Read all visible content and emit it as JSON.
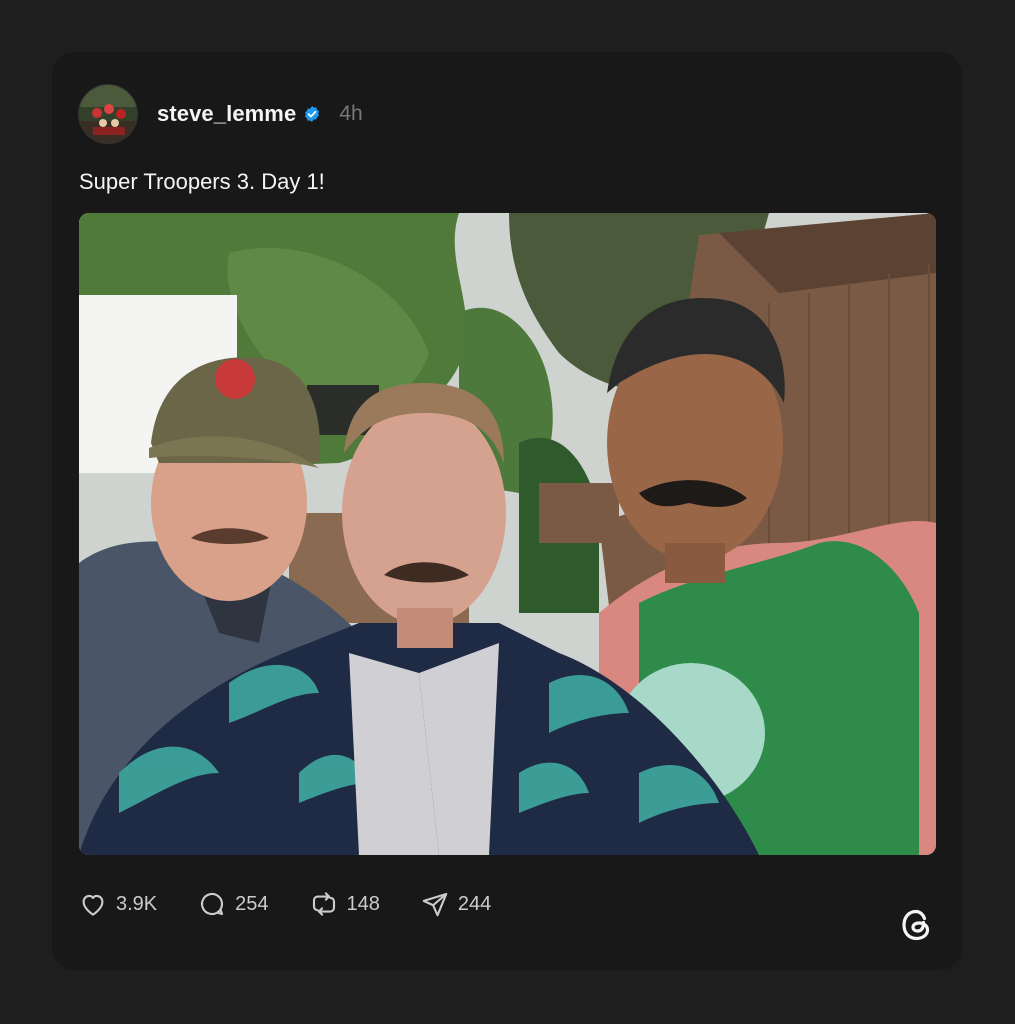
{
  "post": {
    "username": "steve_lemme",
    "verified": true,
    "time_ago": "4h",
    "caption": "Super Troopers 3. Day 1!",
    "photo_alt_icon": "photo-image"
  },
  "actions": {
    "likes": "3.9K",
    "replies": "254",
    "reposts": "148",
    "shares": "244"
  },
  "icons": {
    "like": "heart-icon",
    "reply": "speech-bubble-icon",
    "repost": "repost-arrows-icon",
    "share": "paper-plane-icon",
    "brand": "threads-logo-icon",
    "verified": "verified-badge-icon"
  },
  "colors": {
    "background": "#1e1e1e",
    "card": "#181818",
    "text_primary": "#f3f5f7",
    "text_secondary": "#777777",
    "verified_blue": "#1d9bf0"
  }
}
